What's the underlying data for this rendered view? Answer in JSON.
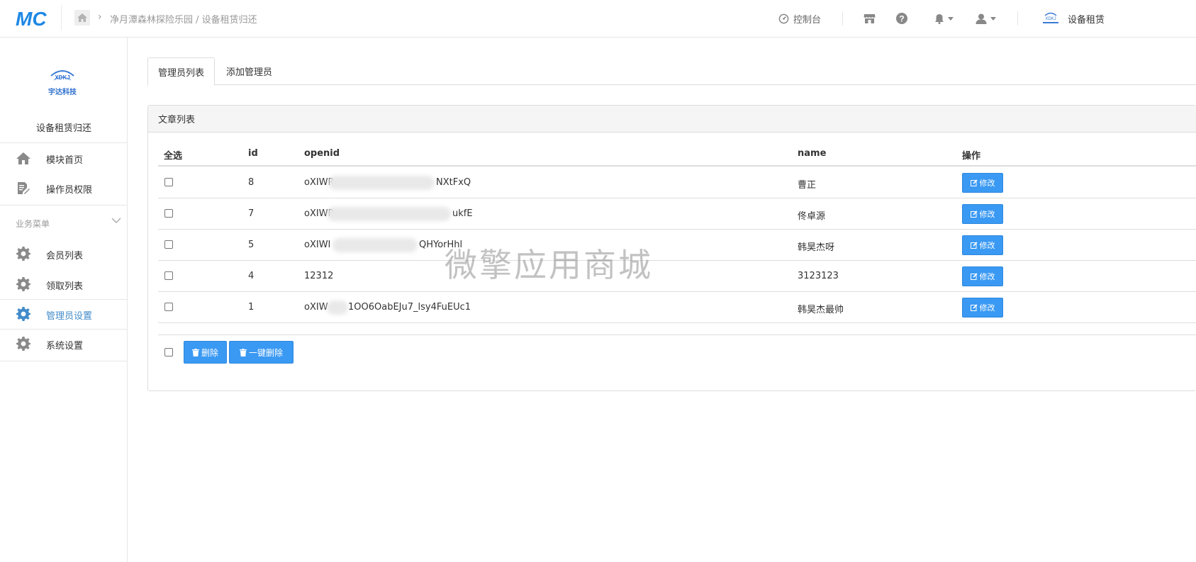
{
  "header": {
    "logo_text": "MC",
    "breadcrumb": "净月潭森林探险乐园 / 设备租赁归还",
    "console_label": "控制台",
    "brand_label": "设备租赁",
    "brand_logo_text": "XDKJ"
  },
  "sidebar": {
    "logo_text": "XDKJ",
    "logo_caption": "宇达科技",
    "title": "设备租赁归还",
    "items": [
      {
        "label": "模块首页",
        "icon": "home-icon"
      },
      {
        "label": "操作员权限",
        "icon": "edit-doc-icon"
      }
    ],
    "group_label": "业务菜单",
    "group_items": [
      {
        "label": "会员列表",
        "icon": "gear-icon"
      },
      {
        "label": "领取列表",
        "icon": "gear-icon"
      },
      {
        "label": "管理员设置",
        "icon": "gear-icon",
        "active": true
      },
      {
        "label": "系统设置",
        "icon": "gear-icon"
      }
    ]
  },
  "tabs": [
    {
      "label": "管理员列表",
      "active": true
    },
    {
      "label": "添加管理员",
      "active": false
    }
  ],
  "panel": {
    "title": "文章列表",
    "columns": [
      "全选",
      "id",
      "openid",
      "name",
      "操作"
    ],
    "rows": [
      {
        "id": "8",
        "openid_start": "oXIWR",
        "openid_end": "NXtFxQ",
        "name": "曹正"
      },
      {
        "id": "7",
        "openid_start": "oXIWR",
        "openid_end": "ukfE",
        "name": "佟卓源"
      },
      {
        "id": "5",
        "openid_start": "oXIWI",
        "openid_end": "QHYorHhl",
        "name": "韩昊杰呀"
      },
      {
        "id": "4",
        "openid_start": "12312",
        "openid_end": "",
        "name": "3123123"
      },
      {
        "id": "1",
        "openid_start": "oXIW",
        "openid_end": "1OO6OabEJu7_lsy4FuEUc1",
        "name": "韩昊杰最帅"
      }
    ],
    "edit_label": "修改",
    "delete_label": "删除",
    "delete_all_label": "一键删除"
  },
  "watermark": "微擎应用商城",
  "colors": {
    "primary": "#3a99f3",
    "active_menu": "#428bca",
    "logo_blue": "#1e88e5"
  }
}
